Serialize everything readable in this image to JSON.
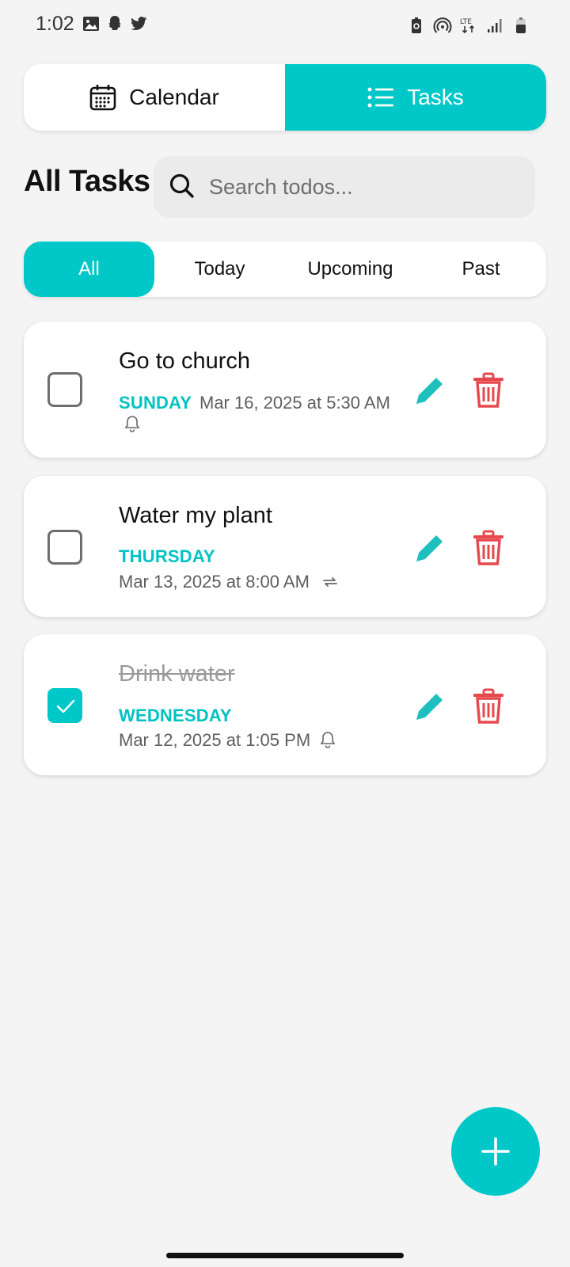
{
  "status_bar": {
    "time": "1:02",
    "left_icons": [
      "gallery-icon",
      "snapchat-icon",
      "twitter-icon"
    ],
    "right_icons": [
      "battery-saver-icon",
      "hotspot-icon",
      "lte-icon",
      "signal-icon",
      "battery-icon"
    ],
    "network_label": "LTE"
  },
  "view_switch": {
    "calendar_label": "Calendar",
    "tasks_label": "Tasks",
    "active": "Tasks"
  },
  "header": {
    "title": "All Tasks",
    "search_placeholder": "Search todos..."
  },
  "filters": {
    "items": [
      "All",
      "Today",
      "Upcoming",
      "Past"
    ],
    "active": "All"
  },
  "tasks": [
    {
      "title": "Go to church",
      "day": "SUNDAY",
      "datetime": "Mar 16, 2025 at 5:30 AM",
      "completed": false,
      "indicator": "bell-icon"
    },
    {
      "title": "Water my plant",
      "day": "THURSDAY",
      "datetime": "Mar 13, 2025 at 8:00 AM",
      "completed": false,
      "indicator": "repeat-icon"
    },
    {
      "title": "Drink water",
      "day": "WEDNESDAY",
      "datetime": "Mar 12, 2025 at 1:05 PM",
      "completed": true,
      "indicator": "bell-icon"
    }
  ],
  "colors": {
    "accent": "#00c8c8",
    "delete": "#e5484d",
    "background": "#f4f4f4",
    "card": "#ffffff"
  }
}
